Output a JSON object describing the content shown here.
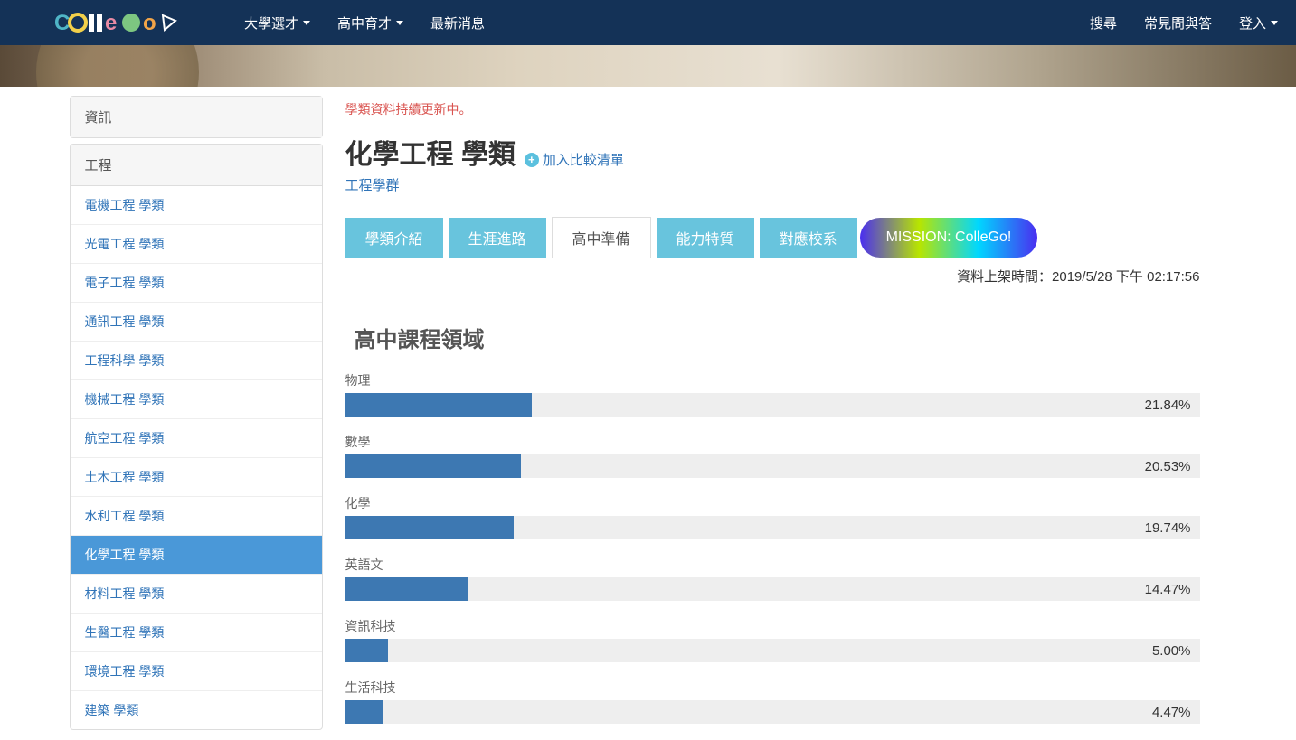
{
  "nav": {
    "left": [
      {
        "label": "大學選才",
        "caret": true
      },
      {
        "label": "高中育才",
        "caret": true
      },
      {
        "label": "最新消息",
        "caret": false
      }
    ],
    "right": [
      {
        "label": "搜尋",
        "caret": false
      },
      {
        "label": "常見問與答",
        "caret": false
      },
      {
        "label": "登入",
        "caret": true
      }
    ]
  },
  "sidebar": {
    "collapsed_groups": [
      "資訊"
    ],
    "group_title": "工程",
    "items": [
      {
        "label": "電機工程 學類",
        "active": false
      },
      {
        "label": "光電工程 學類",
        "active": false
      },
      {
        "label": "電子工程 學類",
        "active": false
      },
      {
        "label": "通訊工程 學類",
        "active": false
      },
      {
        "label": "工程科學 學類",
        "active": false
      },
      {
        "label": "機械工程 學類",
        "active": false
      },
      {
        "label": "航空工程 學類",
        "active": false
      },
      {
        "label": "土木工程 學類",
        "active": false
      },
      {
        "label": "水利工程 學類",
        "active": false
      },
      {
        "label": "化學工程 學類",
        "active": true
      },
      {
        "label": "材料工程 學類",
        "active": false
      },
      {
        "label": "生醫工程 學類",
        "active": false
      },
      {
        "label": "環境工程 學類",
        "active": false
      },
      {
        "label": "建築 學類",
        "active": false
      }
    ]
  },
  "main": {
    "notice": "學類資料持續更新中。",
    "title": "化學工程 學類",
    "add_compare_label": "加入比較清單",
    "cluster_label": "工程學群",
    "tabs": [
      {
        "label": "學類介紹",
        "active": false
      },
      {
        "label": "生涯進路",
        "active": false
      },
      {
        "label": "高中準備",
        "active": true
      },
      {
        "label": "能力特質",
        "active": false
      },
      {
        "label": "對應校系",
        "active": false
      }
    ],
    "mission_label": "MISSION: ColleGo!",
    "upload_time_label": "資料上架時間：",
    "upload_time_value": "2019/5/28 下午 02:17:56",
    "section_title": "高中課程領域"
  },
  "chart_data": {
    "type": "bar",
    "title": "高中課程領域",
    "xlabel": "",
    "ylabel": "",
    "ylim": [
      0,
      100
    ],
    "categories": [
      "物理",
      "數學",
      "化學",
      "英語文",
      "資訊科技",
      "生活科技"
    ],
    "values": [
      21.84,
      20.53,
      19.74,
      14.47,
      5.0,
      4.47
    ],
    "value_display": [
      "21.84%",
      "20.53%",
      "19.74%",
      "14.47%",
      "5.00%",
      "4.47%"
    ]
  }
}
